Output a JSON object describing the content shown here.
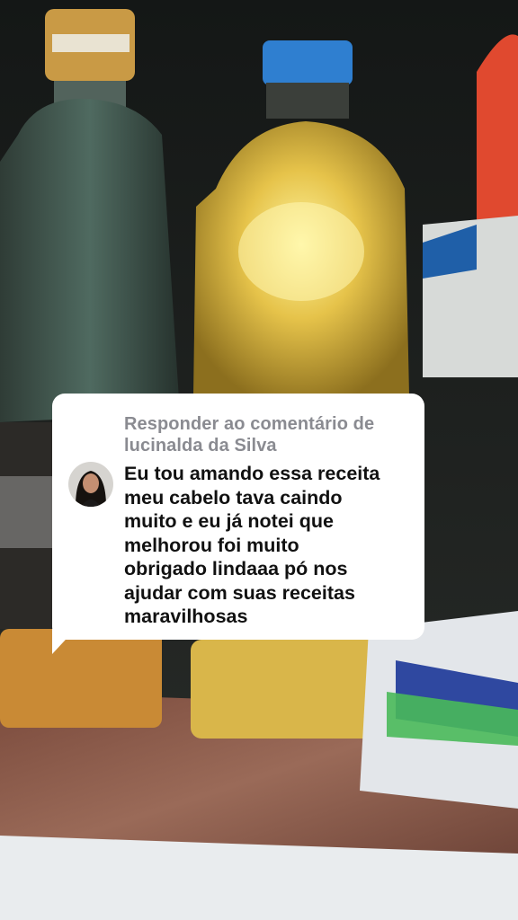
{
  "reply_card": {
    "header_line1": "Responder ao comentário de",
    "header_line2": "lucinalda da Silva",
    "comment_line1": "Eu tou amando essa receita",
    "comment_line2": "meu cabelo tava caindo",
    "comment_line3": "muito e eu já notei que",
    "comment_line4": "melhorou foi muito",
    "comment_line5": "obrigado lindaaa pó nos",
    "comment_line6": "ajudar com suas receitas",
    "comment_line7": "maravilhosas",
    "avatar_icon": "profile-photo-avatar"
  },
  "colors": {
    "card_background": "#ffffff",
    "header_text": "#8a8b91",
    "comment_text": "#111111"
  }
}
